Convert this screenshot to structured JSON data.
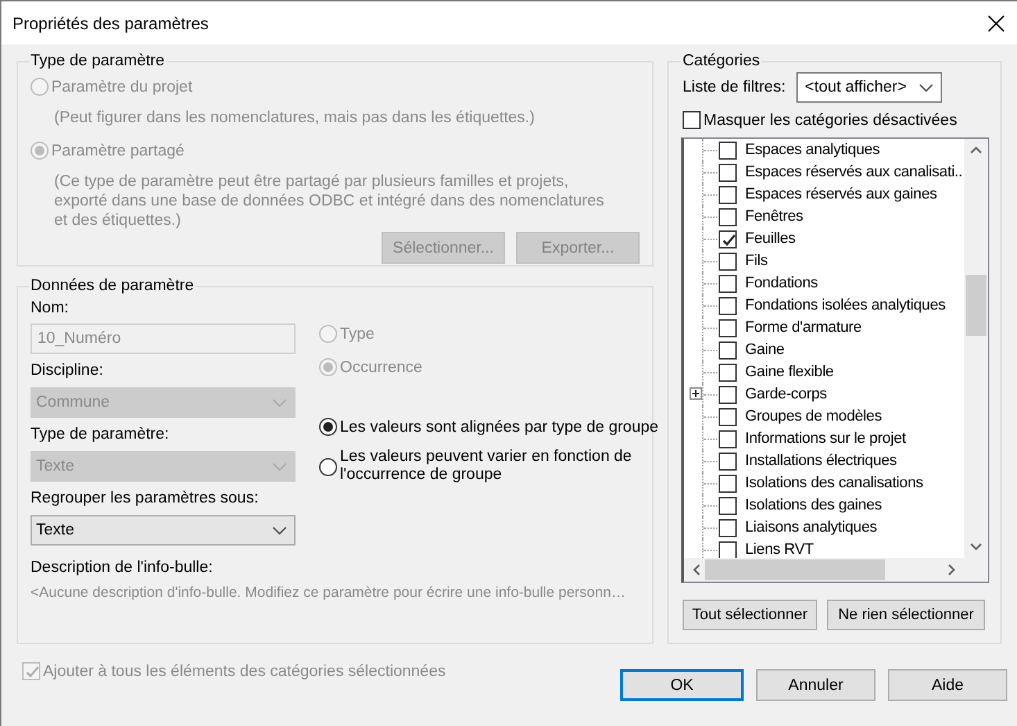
{
  "window": {
    "title": "Propriétés des paramètres"
  },
  "parameter_type": {
    "title": "Type de paramètre",
    "options": [
      {
        "label": "Paramètre du projet",
        "note": "(Peut figurer dans les nomenclatures, mais pas dans les étiquettes.)",
        "selected": false,
        "disabled": true
      },
      {
        "label": "Paramètre partagé",
        "note": "(Ce type de paramètre peut être partagé par plusieurs familles et projets,\nexporté dans une base de données ODBC et intégré dans des nomenclatures\net des étiquettes.)",
        "selected": true,
        "disabled": true
      }
    ],
    "buttons": [
      {
        "label": "Sélectionner...",
        "disabled": true
      },
      {
        "label": "Exporter...",
        "disabled": true
      }
    ]
  },
  "parameter_data": {
    "title": "Données de paramètre",
    "fields": [
      {
        "kind": "input",
        "label": "Nom:",
        "value": "10_Numéro",
        "disabled": true
      },
      {
        "kind": "select",
        "label": "Discipline:",
        "value": "Commune",
        "disabled": true
      },
      {
        "kind": "select",
        "label": "Type de paramètre:",
        "value": "Texte",
        "disabled": true
      },
      {
        "kind": "select",
        "label": "Regrouper les paramètres sous:",
        "value": "Texte",
        "disabled": false
      }
    ],
    "type_options": [
      {
        "label": "Type",
        "selected": false,
        "disabled": true
      },
      {
        "label": "Occurrence",
        "selected": true,
        "disabled": true
      }
    ],
    "group_options": [
      {
        "label": "Les valeurs sont alignées par type de groupe",
        "selected": true,
        "disabled": false
      },
      {
        "label": "Les valeurs peuvent varier en fonction de l'occurrence de groupe",
        "selected": false,
        "disabled": false
      }
    ],
    "tooltip_label": "Description de l'info-bulle:",
    "tooltip_text": "<Aucune description d'info-bulle. Modifiez ce paramètre pour écrire une info-bulle personn…"
  },
  "categories": {
    "title": "Catégories",
    "filter_label": "Liste de filtres:",
    "filter_value": "<tout afficher>",
    "hide_disabled": {
      "label": "Masquer les catégories désactivées",
      "checked": false
    },
    "items": [
      {
        "kind": "leaf",
        "label": "Espaces analytiques",
        "checked": false
      },
      {
        "kind": "leaf",
        "label": "Espaces réservés aux canalisati..",
        "checked": false
      },
      {
        "kind": "leaf",
        "label": "Espaces réservés aux gaines",
        "checked": false
      },
      {
        "kind": "leaf",
        "label": "Fenêtres",
        "checked": false
      },
      {
        "kind": "leaf",
        "label": "Feuilles",
        "checked": true
      },
      {
        "kind": "leaf",
        "label": "Fils",
        "checked": false
      },
      {
        "kind": "leaf",
        "label": "Fondations",
        "checked": false
      },
      {
        "kind": "leaf",
        "label": "Fondations isolées analytiques",
        "checked": false
      },
      {
        "kind": "leaf",
        "label": "Forme d'armature",
        "checked": false
      },
      {
        "kind": "leaf",
        "label": "Gaine",
        "checked": false
      },
      {
        "kind": "leaf",
        "label": "Gaine flexible",
        "checked": false
      },
      {
        "kind": "group",
        "label": "Garde-corps",
        "checked": false
      },
      {
        "kind": "leaf",
        "label": "Groupes de modèles",
        "checked": false
      },
      {
        "kind": "leaf",
        "label": "Informations sur le projet",
        "checked": false
      },
      {
        "kind": "leaf",
        "label": "Installations électriques",
        "checked": false
      },
      {
        "kind": "leaf",
        "label": "Isolations des canalisations",
        "checked": false
      },
      {
        "kind": "leaf",
        "label": "Isolations des gaines",
        "checked": false
      },
      {
        "kind": "leaf",
        "label": "Liaisons analytiques",
        "checked": false
      },
      {
        "kind": "leaf",
        "label": "Liens RVT",
        "checked": false
      }
    ],
    "buttons": [
      "Tout sélectionner",
      "Ne rien sélectionner"
    ]
  },
  "add_to_all": {
    "label": "Ajouter à tous les éléments des catégories sélectionnées",
    "checked": true,
    "disabled": true
  },
  "buttons": [
    {
      "label": "OK",
      "default": true
    },
    {
      "label": "Annuler",
      "default": false
    },
    {
      "label": "Aide",
      "default": false
    }
  ]
}
